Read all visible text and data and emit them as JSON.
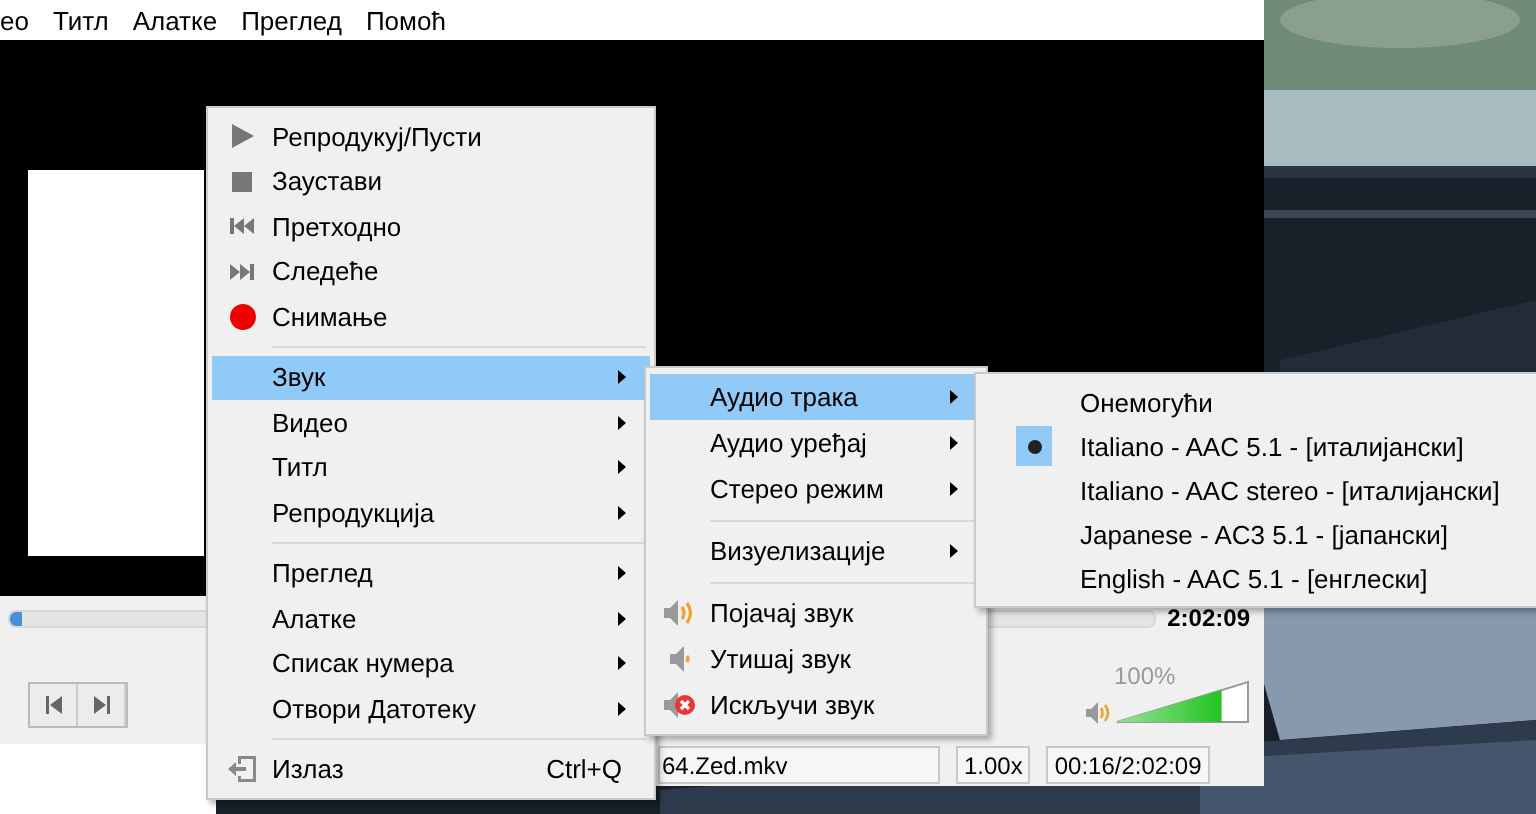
{
  "menu_bar": {
    "items": [
      "ео",
      "Титл",
      "Алатке",
      "Преглед",
      "Помоћ"
    ]
  },
  "player": {
    "seek_bar": {
      "level": 0.01
    },
    "total_time": "2:02:09",
    "volume": {
      "reading": "100%",
      "level": 0.8
    }
  },
  "status_bar": {
    "file_name": "64.Zed.mkv",
    "speed": "1.00x",
    "time": "00:16/2:02:09"
  },
  "context_menu": {
    "items": [
      {
        "kind": "play",
        "label": "Репродукуј/Пусти",
        "selected": false
      },
      {
        "kind": "stop",
        "label": "Заустави",
        "selected": false
      },
      {
        "kind": "previous",
        "label": "Претходно",
        "selected": false
      },
      {
        "kind": "next",
        "label": "Следеће",
        "selected": false
      },
      {
        "kind": "record",
        "label": "Снимање",
        "selected": false
      },
      {
        "kind": "separator"
      },
      {
        "kind": "submenu",
        "label": "Звук",
        "selected": true
      },
      {
        "kind": "submenu",
        "label": "Видео",
        "selected": false
      },
      {
        "kind": "submenu",
        "label": "Титл",
        "selected": false
      },
      {
        "kind": "submenu",
        "label": "Репродукција",
        "selected": false
      },
      {
        "kind": "separator"
      },
      {
        "kind": "submenu",
        "label": "Преглед",
        "selected": false
      },
      {
        "kind": "submenu",
        "label": "Алатке",
        "selected": false
      },
      {
        "kind": "submenu",
        "label": "Списак нумера",
        "selected": false
      },
      {
        "kind": "submenu",
        "label": "Отвори Датотеку",
        "selected": false
      },
      {
        "kind": "separator"
      },
      {
        "kind": "exit",
        "label": "Излаз",
        "shortcut": "Ctrl+Q",
        "selected": false
      }
    ]
  },
  "audio_submenu": {
    "items": [
      {
        "kind": "submenu",
        "label": "Аудио трака",
        "selected": true
      },
      {
        "kind": "submenu",
        "label": "Аудио уређај",
        "selected": false
      },
      {
        "kind": "submenu",
        "label": "Стерео режим",
        "selected": false
      },
      {
        "kind": "separator"
      },
      {
        "kind": "submenu",
        "label": "Визуелизације",
        "selected": false
      },
      {
        "kind": "separator"
      },
      {
        "kind": "volume-up",
        "label": "Појачај звук",
        "selected": false
      },
      {
        "kind": "volume-down",
        "label": "Утишај звук",
        "selected": false
      },
      {
        "kind": "mute",
        "label": "Искључи звук",
        "selected": false
      }
    ]
  },
  "track_submenu": {
    "items": [
      {
        "label": "Онемогући",
        "checked": false
      },
      {
        "label": "Italiano - AAC 5.1 - [италијански]",
        "checked": true
      },
      {
        "label": "Italiano - AAC stereo - [италијански]",
        "checked": false
      },
      {
        "label": "Japanese - AC3 5.1 - [јапански]",
        "checked": false
      },
      {
        "label": "English - AAC 5.1 - [енглески]",
        "checked": false
      }
    ]
  }
}
